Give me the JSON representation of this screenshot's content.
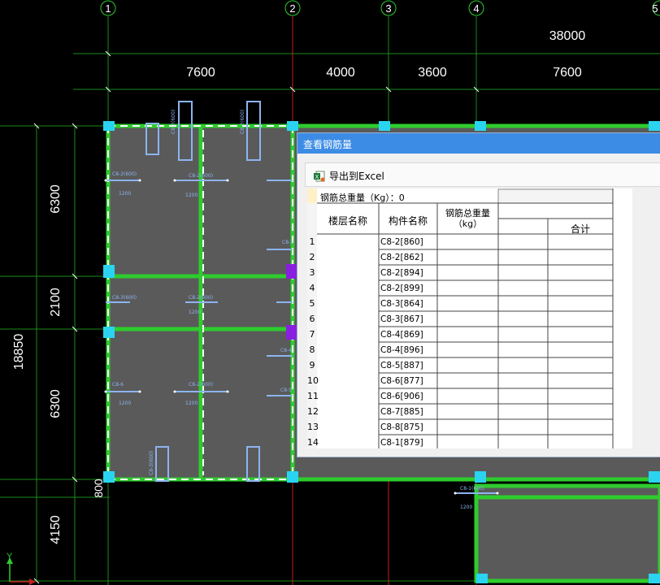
{
  "cad": {
    "axis_labels": [
      "1",
      "2",
      "3",
      "4",
      "5"
    ],
    "top_dims": {
      "total": "38000",
      "spans": [
        "7600",
        "4000",
        "3600",
        "7600"
      ]
    },
    "left_dims": {
      "total": "18850",
      "spans": [
        "6300",
        "2100",
        "6300",
        "800",
        "4150"
      ]
    },
    "beam_labels": [
      "C8-2(600)",
      "C8-2(600)",
      "C8-3",
      "C8-3(600)",
      "C8-2(600)",
      "C8-4",
      "C8-5",
      "C8-6",
      "C8-2(600)",
      "C8-1(600)",
      "C8-2(600)",
      "C8-2(600)",
      "C8-3(600)"
    ],
    "beam_sublabels": [
      "1200",
      "1200",
      "1200",
      "1200",
      "1200",
      "1200"
    ],
    "ucs_y": "Y",
    "colors": {
      "background": "#000000",
      "grid_line": "#1a8a1a",
      "axis_red": "#c81e1e",
      "beam_green": "#2ecc2e",
      "slab_fill": "#5a5a5a",
      "column_cyan": "#2ad4f0",
      "column_purple": "#8a1ee0",
      "rebar_blue": "#8cb4f0"
    }
  },
  "dialog": {
    "title": "查看钢筋量",
    "export_label": "导出到Excel",
    "export_icon": "excel-icon",
    "total_weight_label": "钢筋总重量（Kg）：0",
    "headers": {
      "floor": "楼层名称",
      "component": "构件名称",
      "weight": "钢筋总重量\n（kg）",
      "sum": "合计"
    },
    "rows": [
      {
        "num": "1",
        "name": "C8-2[860]"
      },
      {
        "num": "2",
        "name": "C8-2[862]"
      },
      {
        "num": "3",
        "name": "C8-2[894]"
      },
      {
        "num": "4",
        "name": "C8-2[899]"
      },
      {
        "num": "5",
        "name": "C8-3[864]"
      },
      {
        "num": "6",
        "name": "C8-3[867]"
      },
      {
        "num": "7",
        "name": "C8-4[869]"
      },
      {
        "num": "8",
        "name": "C8-4[896]"
      },
      {
        "num": "9",
        "name": "C8-5[887]"
      },
      {
        "num": "10",
        "name": "C8-6[877]"
      },
      {
        "num": "11",
        "name": "C8-6[906]"
      },
      {
        "num": "12",
        "name": "C8-7[885]"
      },
      {
        "num": "13",
        "name": "C8-8[875]"
      },
      {
        "num": "14",
        "name": "C8-1[879]"
      }
    ],
    "colors": {
      "title_bar": "#3c8ce6",
      "selected_row_marker": "#fff0c8"
    }
  }
}
